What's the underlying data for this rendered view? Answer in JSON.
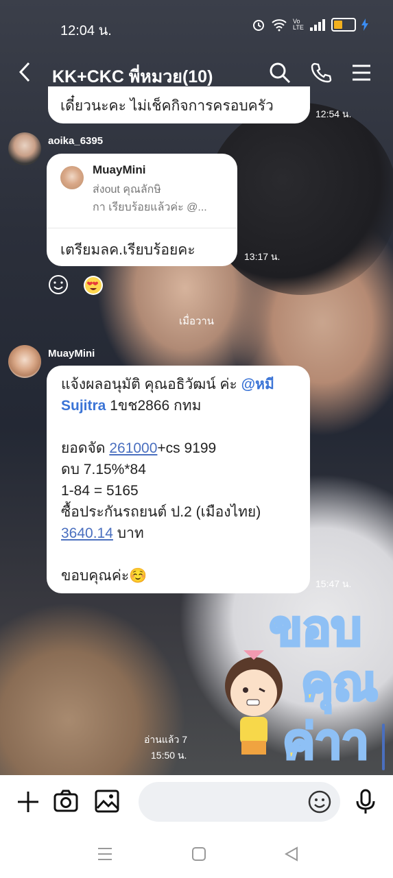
{
  "status_bar": {
    "time": "12:04 น.",
    "network": "Vo LTE"
  },
  "header": {
    "title": "KK+CKC พี่หมวย(10)"
  },
  "messages": {
    "m0": {
      "text": "เดี๋ยวนะคะ ไม่เช็คกิจการครอบครัว",
      "time": "12:54 น."
    },
    "m1": {
      "sender": "aoika_6395",
      "reply_name": "MuayMini",
      "reply_preview": [
        "ส่งout คุณลักษิ",
        "กา เรียบร้อยแล้วค่ะ @..."
      ],
      "text": "เตรียมลค.เรียบร้อยคะ",
      "time": "13:17 น."
    },
    "date_separator": "เมื่อวาน",
    "m2": {
      "sender": "MuayMini",
      "line1": "แจ้งผลอนุมัติ คุณอธิวัฒน์ ค่ะ ",
      "mention1": "@หมี",
      "mention2": "Sujitra",
      "line2_rest": " 1ขช2866 กทม",
      "line3_prefix": "ยอดจัด ",
      "line3_link": "261000",
      "line3_rest": "+cs 9199",
      "line4": "ดบ 7.15%*84",
      "line5": "1-84 = 5165",
      "line6": "ซื้อประกันรถยนต์ ป.2 (เมืองไทย)",
      "line7_link": "3640.14",
      "line7_rest": " บาท",
      "line8": "ขอบคุณค่ะ☺️",
      "time": "15:47 น."
    },
    "m3": {
      "read": "อ่านแล้ว 7",
      "time": "15:50 น.",
      "sticker_text": "ขอบคุณค่า"
    }
  },
  "colors": {
    "bubble": "#ffffff",
    "link": "#4a6fbf",
    "battery": "#f2b01e"
  }
}
